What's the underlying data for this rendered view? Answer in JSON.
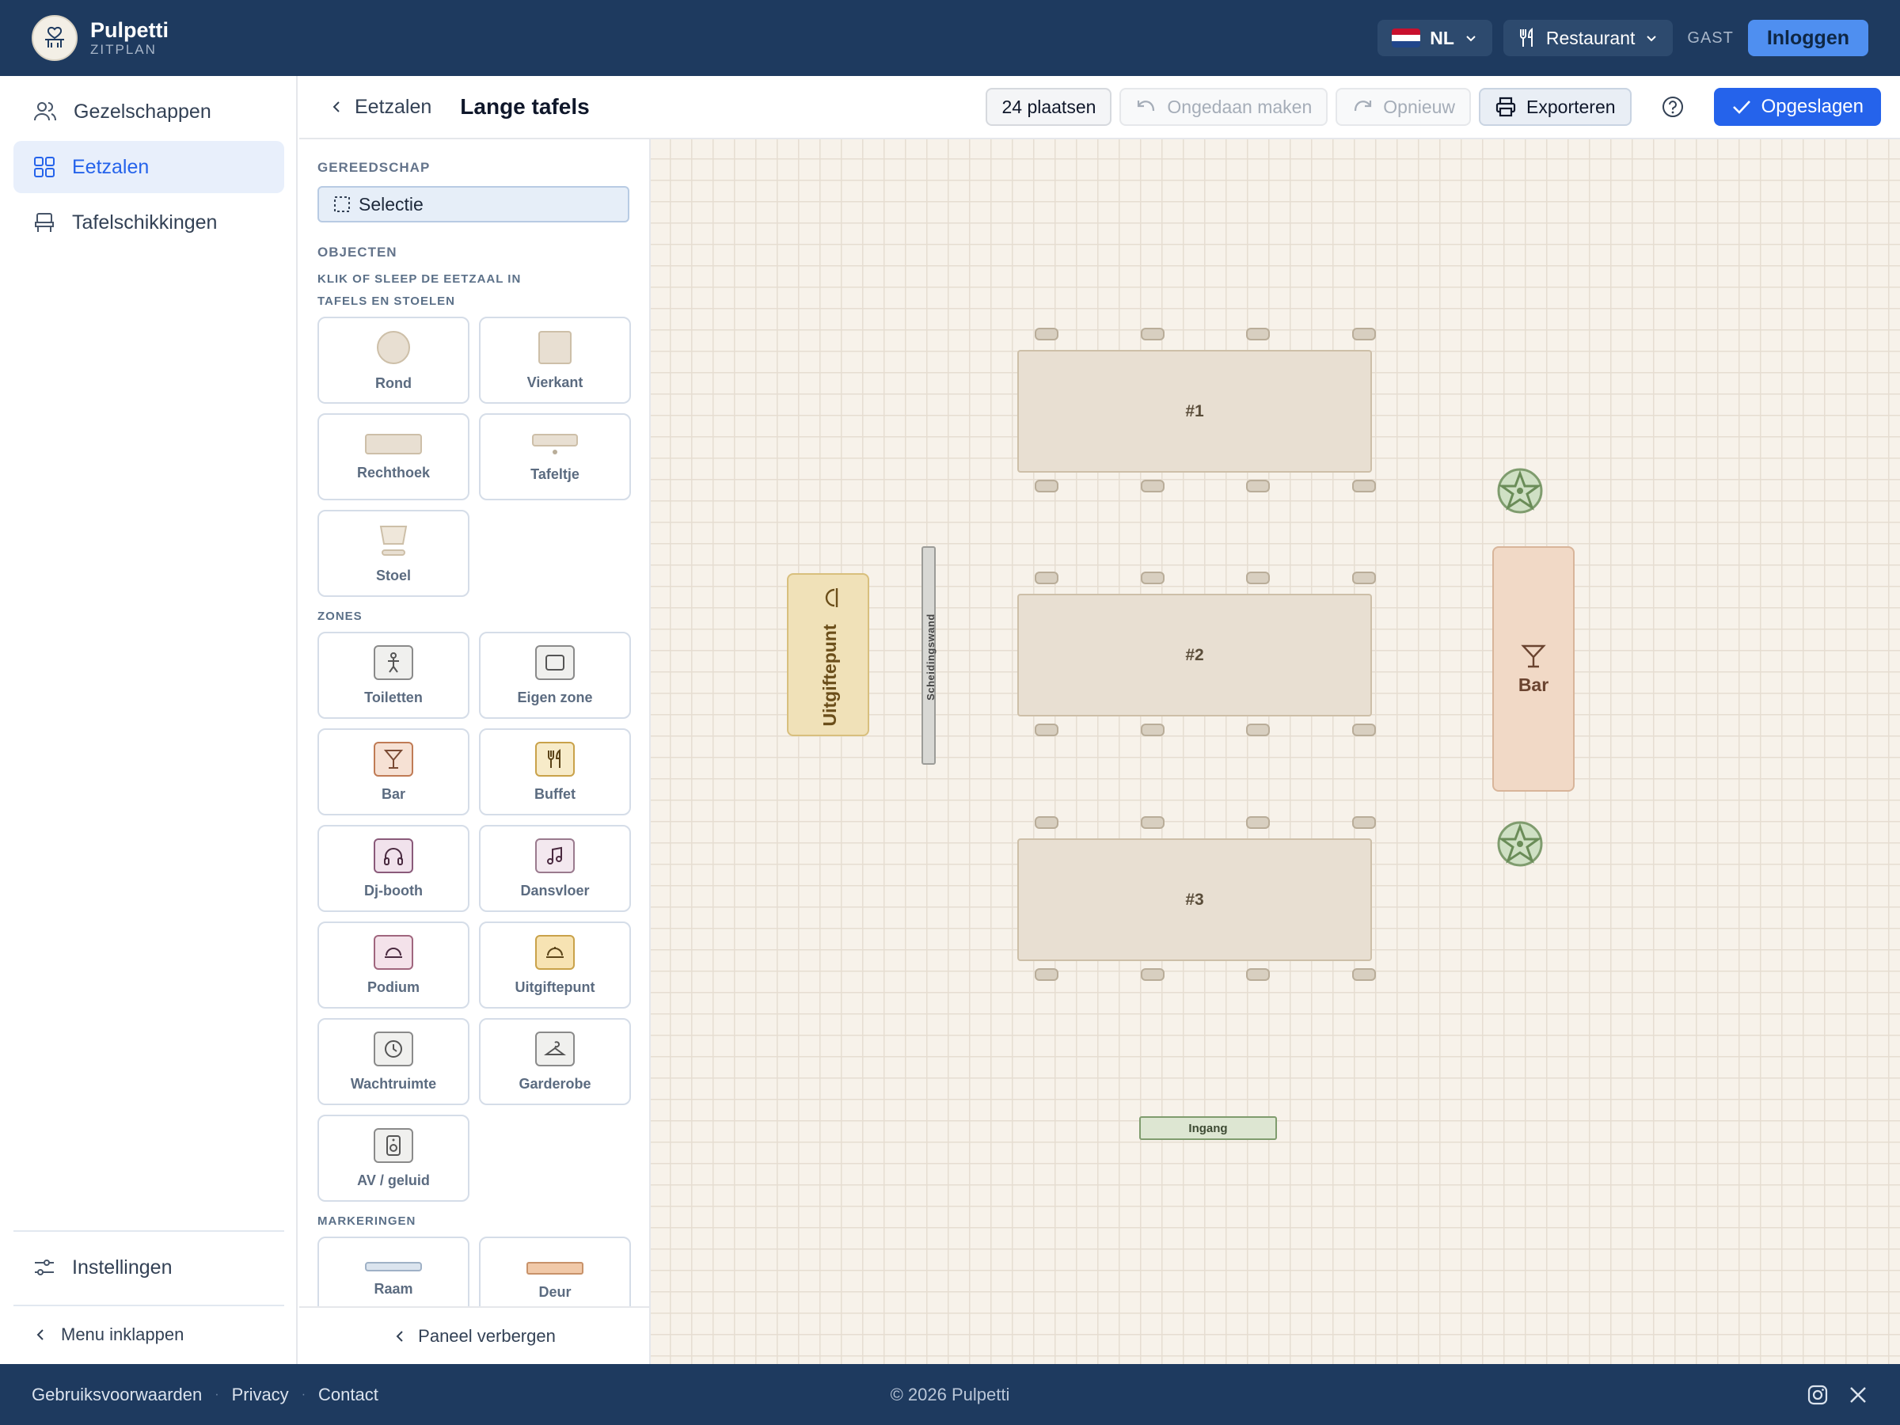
{
  "header": {
    "brand_name": "Pulpetti",
    "brand_sub": "ZITPLAN",
    "language": "NL",
    "venue_type": "Restaurant",
    "guest_label": "GAST",
    "login_label": "Inloggen"
  },
  "sidebar": {
    "items": [
      {
        "label": "Gezelschappen",
        "icon": "users-icon"
      },
      {
        "label": "Eetzalen",
        "icon": "grid-icon"
      },
      {
        "label": "Tafelschikkingen",
        "icon": "chair-icon"
      }
    ],
    "settings_label": "Instellingen",
    "collapse_label": "Menu inklappen"
  },
  "subheader": {
    "back_label": "Eetzalen",
    "title": "Lange tafels",
    "seats": "24 plaatsen",
    "undo_label": "Ongedaan maken",
    "redo_label": "Opnieuw",
    "export_label": "Exporteren",
    "saved_label": "Opgeslagen"
  },
  "panel": {
    "tools_heading": "GEREEDSCHAP",
    "select_label": "Selectie",
    "objects_heading": "OBJECTEN",
    "objects_hint": "KLIK OF SLEEP DE EETZAAL IN",
    "tables_heading": "TAFELS EN STOELEN",
    "tables": [
      "Rond",
      "Vierkant",
      "Rechthoek",
      "Tafeltje",
      "Stoel"
    ],
    "zones_heading": "ZONES",
    "zones": [
      "Toiletten",
      "Eigen zone",
      "Bar",
      "Buffet",
      "Dj-booth",
      "Dansvloer",
      "Podium",
      "Uitgiftepunt",
      "Wachtruimte",
      "Garderobe",
      "AV / geluid"
    ],
    "markings_heading": "MARKERINGEN",
    "markings": [
      "Raam",
      "Deur"
    ],
    "hide_label": "Paneel verbergen"
  },
  "canvas": {
    "tables": [
      "#1",
      "#2",
      "#3"
    ],
    "serving_point": "Uitgiftepunt",
    "partition": "Scheidingswand",
    "bar": "Bar",
    "entrance": "Ingang"
  },
  "footer": {
    "links": [
      "Gebruiksvoorwaarden",
      "Privacy",
      "Contact"
    ],
    "copyright": "© 2026 Pulpetti"
  },
  "colors": {
    "header_bg": "#1e3a5f",
    "accent": "#2563eb",
    "canvas_bg": "#f7f2ea"
  }
}
